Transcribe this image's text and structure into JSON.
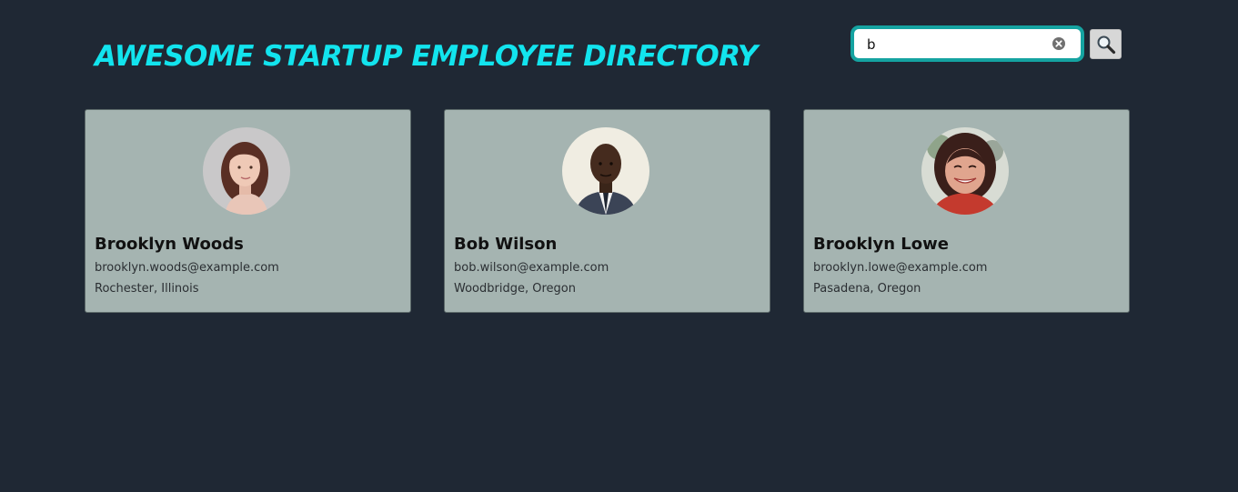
{
  "header": {
    "title": "AWESOME STARTUP EMPLOYEE DIRECTORY"
  },
  "search": {
    "value": "b",
    "button_icon": "search-icon",
    "clear_icon": "clear-icon"
  },
  "employees": [
    {
      "name": "Brooklyn Woods",
      "email": "brooklyn.woods@example.com",
      "location": "Rochester, Illinois"
    },
    {
      "name": "Bob Wilson",
      "email": "bob.wilson@example.com",
      "location": "Woodbridge, Oregon"
    },
    {
      "name": "Brooklyn Lowe",
      "email": "brooklyn.lowe@example.com",
      "location": "Pasadena, Oregon"
    }
  ],
  "colors": {
    "background": "#1f2834",
    "title": "#12e4ee",
    "card": "#a5b4b1",
    "search_border": "#15a3a1"
  }
}
